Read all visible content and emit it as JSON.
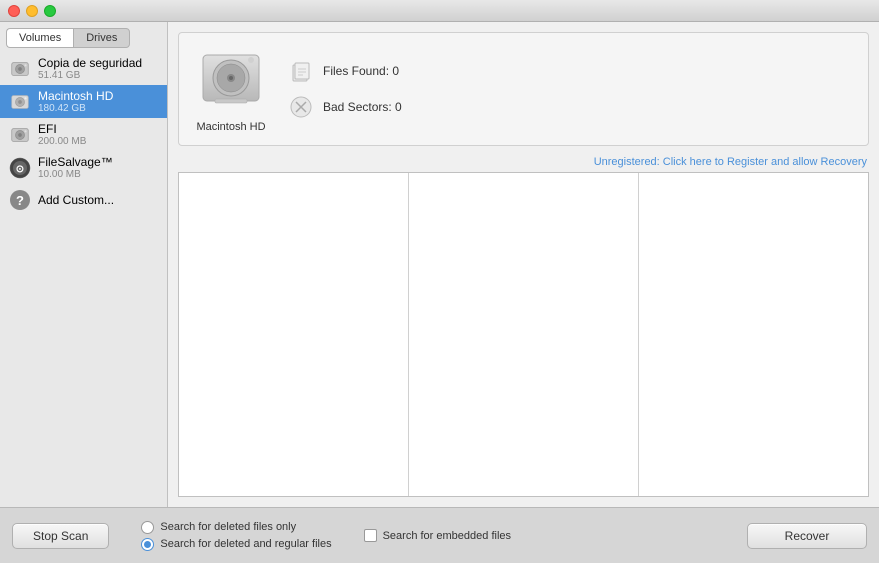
{
  "titlebar": {
    "traffic_lights": [
      "close",
      "minimize",
      "maximize"
    ]
  },
  "sidebar": {
    "tabs": [
      {
        "id": "volumes",
        "label": "Volumes"
      },
      {
        "id": "drives",
        "label": "Drives"
      }
    ],
    "active_tab": "volumes",
    "items": [
      {
        "id": "copia",
        "name": "Copia de seguridad",
        "sub": "51.41 GB",
        "type": "hd",
        "selected": false
      },
      {
        "id": "macintosh",
        "name": "Macintosh HD",
        "sub": "180.42 GB",
        "type": "hd",
        "selected": true
      },
      {
        "id": "efi",
        "name": "EFI",
        "sub": "200.00 MB",
        "type": "hd-small",
        "selected": false
      },
      {
        "id": "filesalvage",
        "name": "FileSalvage™",
        "sub": "10.00 MB",
        "type": "app",
        "selected": false
      },
      {
        "id": "addcustom",
        "name": "Add Custom...",
        "sub": "",
        "type": "question",
        "selected": false
      }
    ]
  },
  "drive_panel": {
    "drive_name": "Macintosh HD",
    "files_found_label": "Files Found:",
    "files_found_value": "0",
    "bad_sectors_label": "Bad Sectors:",
    "bad_sectors_value": "0"
  },
  "reg_link": {
    "text": "Unregistered: Click here to Register and allow Recovery"
  },
  "file_columns": [
    {
      "id": "col1"
    },
    {
      "id": "col2"
    },
    {
      "id": "col3"
    }
  ],
  "bottom_bar": {
    "stop_scan_label": "Stop Scan",
    "radio_options": [
      {
        "id": "deleted_only",
        "label": "Search for deleted files only",
        "active": false
      },
      {
        "id": "deleted_regular",
        "label": "Search for deleted and regular files",
        "active": true
      }
    ],
    "checkbox_options": [
      {
        "id": "embedded",
        "label": "Search for embedded files",
        "checked": false
      }
    ],
    "recover_label": "Recover"
  }
}
